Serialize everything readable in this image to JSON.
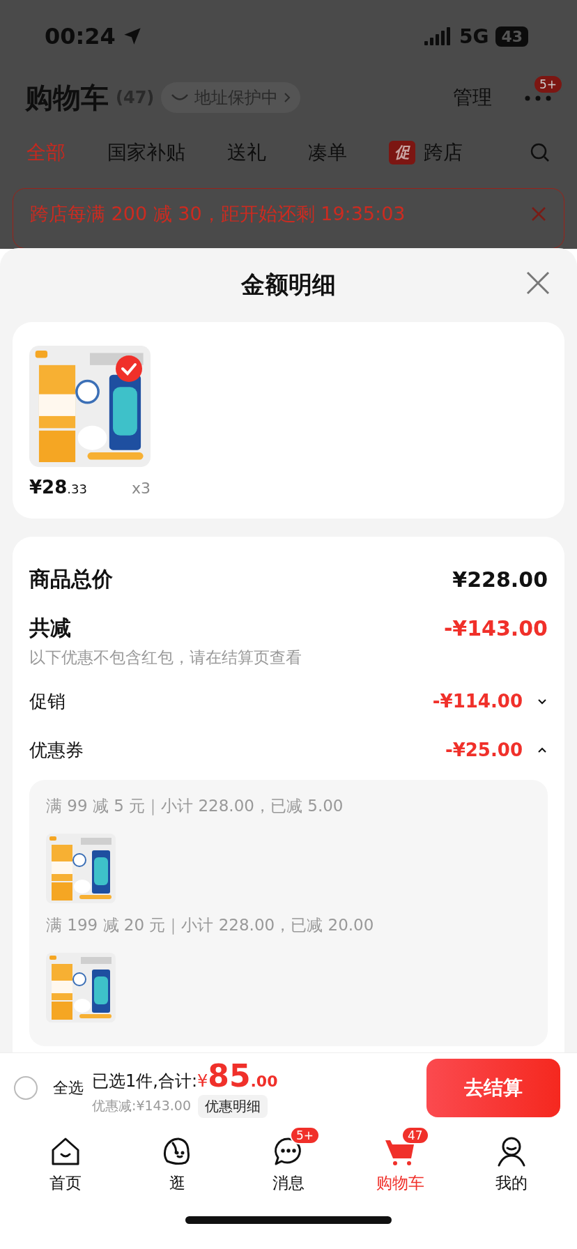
{
  "status_bar": {
    "time": "00:24",
    "network": "5G",
    "battery": "43"
  },
  "header": {
    "title": "购物车",
    "count": "(47)",
    "address_pill": "地址保护中",
    "manage": "管理",
    "more_badge": "5+"
  },
  "tabs": [
    {
      "label": "全部",
      "selected": true
    },
    {
      "label": "国家补贴",
      "selected": false
    },
    {
      "label": "送礼",
      "selected": false
    },
    {
      "label": "凑单",
      "selected": false
    },
    {
      "label": "跨店",
      "selected": false,
      "badge": "促"
    }
  ],
  "promo_banner": {
    "text": "跨店每满 200 减 30，距开始还剩 19:35:03"
  },
  "sheet": {
    "title": "金额明细",
    "products": [
      {
        "kind": "picture",
        "selected": true,
        "price_main": "¥28",
        "price_decimal": ".33",
        "quantity": "x3"
      }
    ],
    "summary_rows": [
      {
        "kind": "total",
        "label": "商品总价",
        "amount": "¥228.00"
      },
      {
        "kind": "discount_total",
        "label": "共减",
        "amount": "-¥143.00",
        "note": "以下优惠不包含红包，请在结算页查看"
      },
      {
        "kind": "detail",
        "label": "促销",
        "amount": "-¥114.00",
        "expanded": false
      },
      {
        "kind": "detail",
        "label": "优惠券",
        "amount": "-¥25.00",
        "expanded": true,
        "groups": [
          {
            "text": "满 99 减 5 元｜小计 228.00，已减 5.00",
            "kind": "picture"
          },
          {
            "text": "满 199 减 20 元｜小计 228.00，已减 20.00",
            "kind": "picture"
          }
        ]
      }
    ]
  },
  "bottom_bar": {
    "select_all": {
      "label": "全选",
      "checked": false
    },
    "selected_text": "已选1件,合计:",
    "currency": "¥",
    "total_main": "85",
    "total_decimal": ".00",
    "discount_text": "优惠减:¥143.00",
    "details_button": "优惠明细",
    "checkout": "去结算"
  },
  "nav": [
    {
      "kind": "home",
      "label": "首页",
      "selected": false
    },
    {
      "kind": "browse",
      "label": "逛",
      "selected": false
    },
    {
      "kind": "messages",
      "label": "消息",
      "selected": false,
      "badge": "5+"
    },
    {
      "kind": "cart",
      "label": "购物车",
      "selected": true,
      "badge": "47"
    },
    {
      "kind": "profile",
      "label": "我的",
      "selected": false
    }
  ]
}
